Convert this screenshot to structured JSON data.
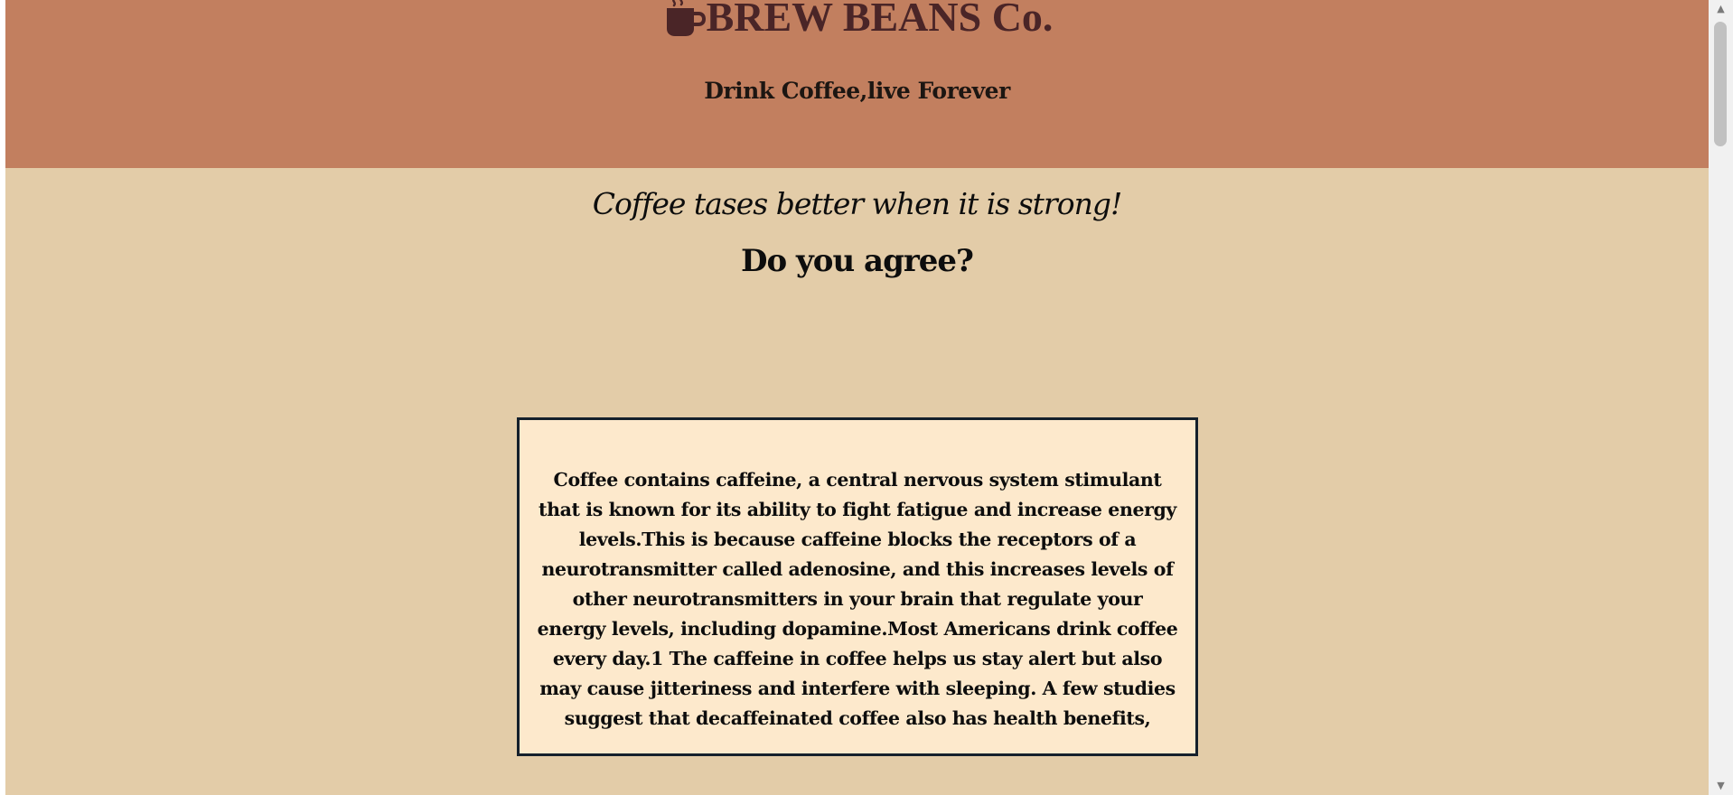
{
  "header": {
    "brand": "BREW BEANS Co.",
    "brand_icon": "coffee-cup-icon",
    "tagline": "Drink Coffee,live Forever"
  },
  "main": {
    "quote": "Coffee tases better when it is strong!",
    "question": "Do you agree?",
    "info_text": "Coffee contains caffeine, a central nervous system stimulant that is known for its ability to fight fatigue and increase energy levels.This is because caffeine blocks the receptors of a neurotransmitter called adenosine, and this increases levels of other neurotransmitters in your brain that regulate your energy levels, including dopamine.Most Americans drink coffee every day.1 The caffeine in coffee helps us stay alert but also may cause jitteriness and interfere with sleeping. A few studies suggest that decaffeinated coffee also has health benefits,"
  },
  "scrollbar": {
    "up_icon": "scroll-up-arrow-icon",
    "down_icon": "scroll-down-arrow-icon"
  },
  "colors": {
    "header_bg": "#c27f5f",
    "page_bg": "#e3cca8",
    "box_bg": "#fde9cc",
    "box_border": "#15202c",
    "brand_text": "#4a2527"
  }
}
